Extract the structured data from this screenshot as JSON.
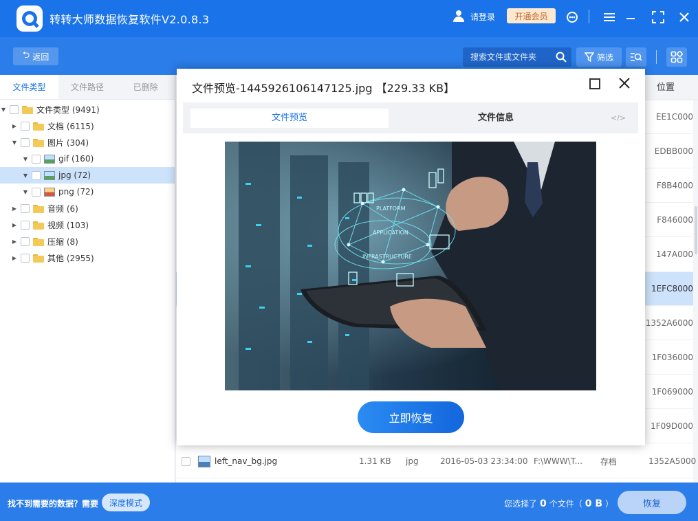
{
  "app": {
    "title": "转转大师数据恢复软件V2.0.8.3",
    "login_label": "请登录",
    "vip_label": "开通会员"
  },
  "toolbar": {
    "back_label": "返回",
    "search_placeholder": "搜索文件或文件夹",
    "filter_label": "筛选"
  },
  "left_tabs": [
    "文件类型",
    "文件路径",
    "已删除"
  ],
  "tree": [
    {
      "label": "文件类型 (9491)",
      "toggle": "▼",
      "icon": "folder"
    },
    {
      "label": "文档 (6115)",
      "toggle": "▶",
      "icon": "folder"
    },
    {
      "label": "图片 (304)",
      "toggle": "▼",
      "icon": "folder"
    },
    {
      "label": "gif (160)",
      "toggle": "▼",
      "icon": "image"
    },
    {
      "label": "jpg (72)",
      "toggle": "▼",
      "icon": "image",
      "selected": true
    },
    {
      "label": "png (72)",
      "toggle": "▼",
      "icon": "image-png"
    },
    {
      "label": "音频 (6)",
      "toggle": "▶",
      "icon": "folder"
    },
    {
      "label": "视频 (103)",
      "toggle": "▶",
      "icon": "folder"
    },
    {
      "label": "压缩 (8)",
      "toggle": "▶",
      "icon": "folder"
    },
    {
      "label": "其他 (2955)",
      "toggle": "▶",
      "icon": "folder"
    }
  ],
  "position_column": {
    "header": "位置",
    "values": [
      "EE1C000",
      "EDBB000",
      "F8B4000",
      "F846000",
      "147A000",
      "1EFC8000",
      "1352A6000",
      "1F036000",
      "1F069000",
      "1F09D000"
    ],
    "selected_index": 5
  },
  "visible_file_row": {
    "name": "left_nav_bg.jpg",
    "size": "1.31 KB",
    "type": "jpg",
    "date": "2016-05-03 23:34:00",
    "path": "F:\\WWW\\T...",
    "status": "存档",
    "position": "1352A5000"
  },
  "footer": {
    "hint": "找不到需要的数据？需要",
    "deep_mode_label": "深度模式",
    "selected_prefix": "您选择了",
    "selected_count": "0",
    "selected_mid": "个文件（",
    "selected_size": "0 B",
    "selected_suffix": "）",
    "recover_label": "恢复"
  },
  "dialog": {
    "title": "文件预览-1445926106147125.jpg 【229.33 KB】",
    "tab_preview": "文件预览",
    "tab_info": "文件信息",
    "tab_code": "</>",
    "restore_label": "立即恢复"
  },
  "colors": {
    "brand_blue": "#1a73e8",
    "toolbar_blue": "#2b7de9",
    "selection": "#cde3fb",
    "vip_bg": "#fde8d0"
  }
}
